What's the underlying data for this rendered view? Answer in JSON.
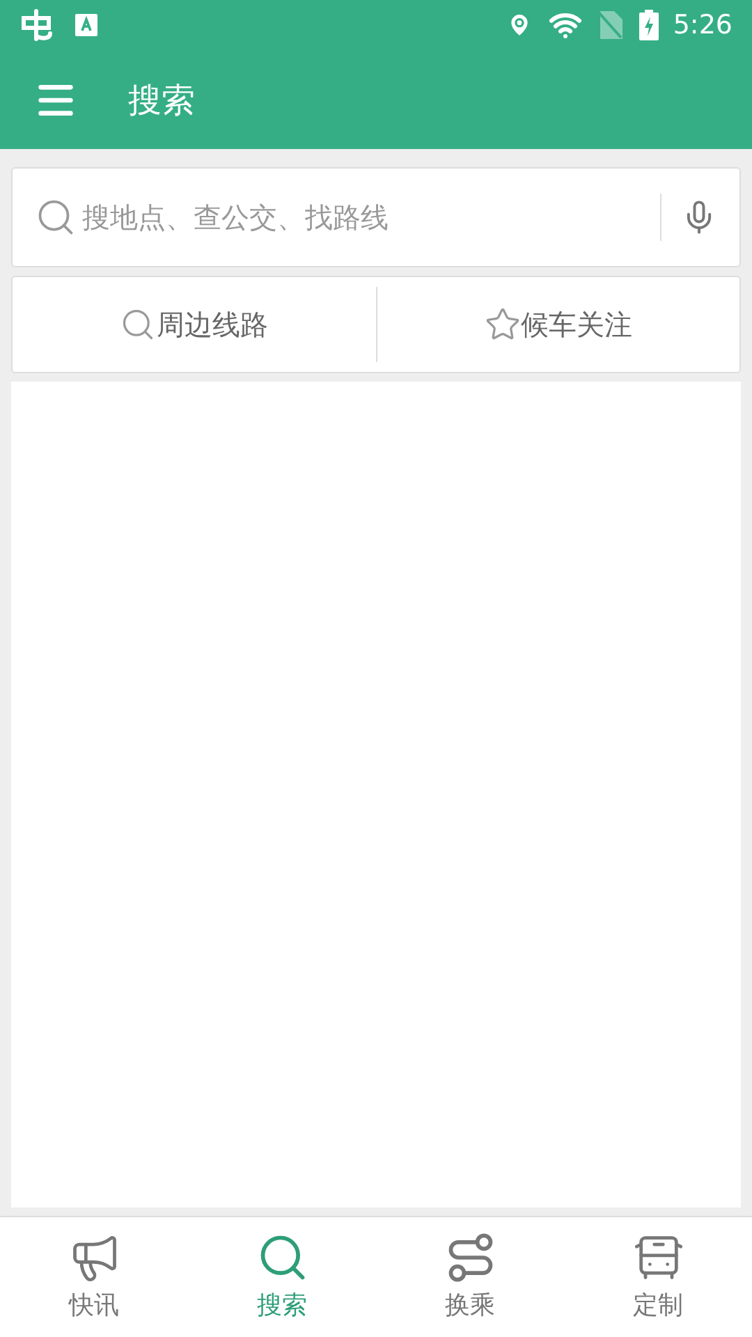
{
  "status_bar": {
    "time": "5:26"
  },
  "app_bar": {
    "title": "搜索"
  },
  "search": {
    "placeholder": "搜地点、查公交、找路线"
  },
  "quick_actions": [
    {
      "label": "周边线路",
      "kind": "search"
    },
    {
      "label": "候车关注",
      "kind": "star"
    }
  ],
  "bottom_nav": [
    {
      "label": "快讯",
      "kind": "news",
      "selected": false
    },
    {
      "label": "搜索",
      "kind": "search",
      "selected": true
    },
    {
      "label": "换乘",
      "kind": "transfer",
      "selected": false
    },
    {
      "label": "定制",
      "kind": "custom",
      "selected": false
    }
  ]
}
